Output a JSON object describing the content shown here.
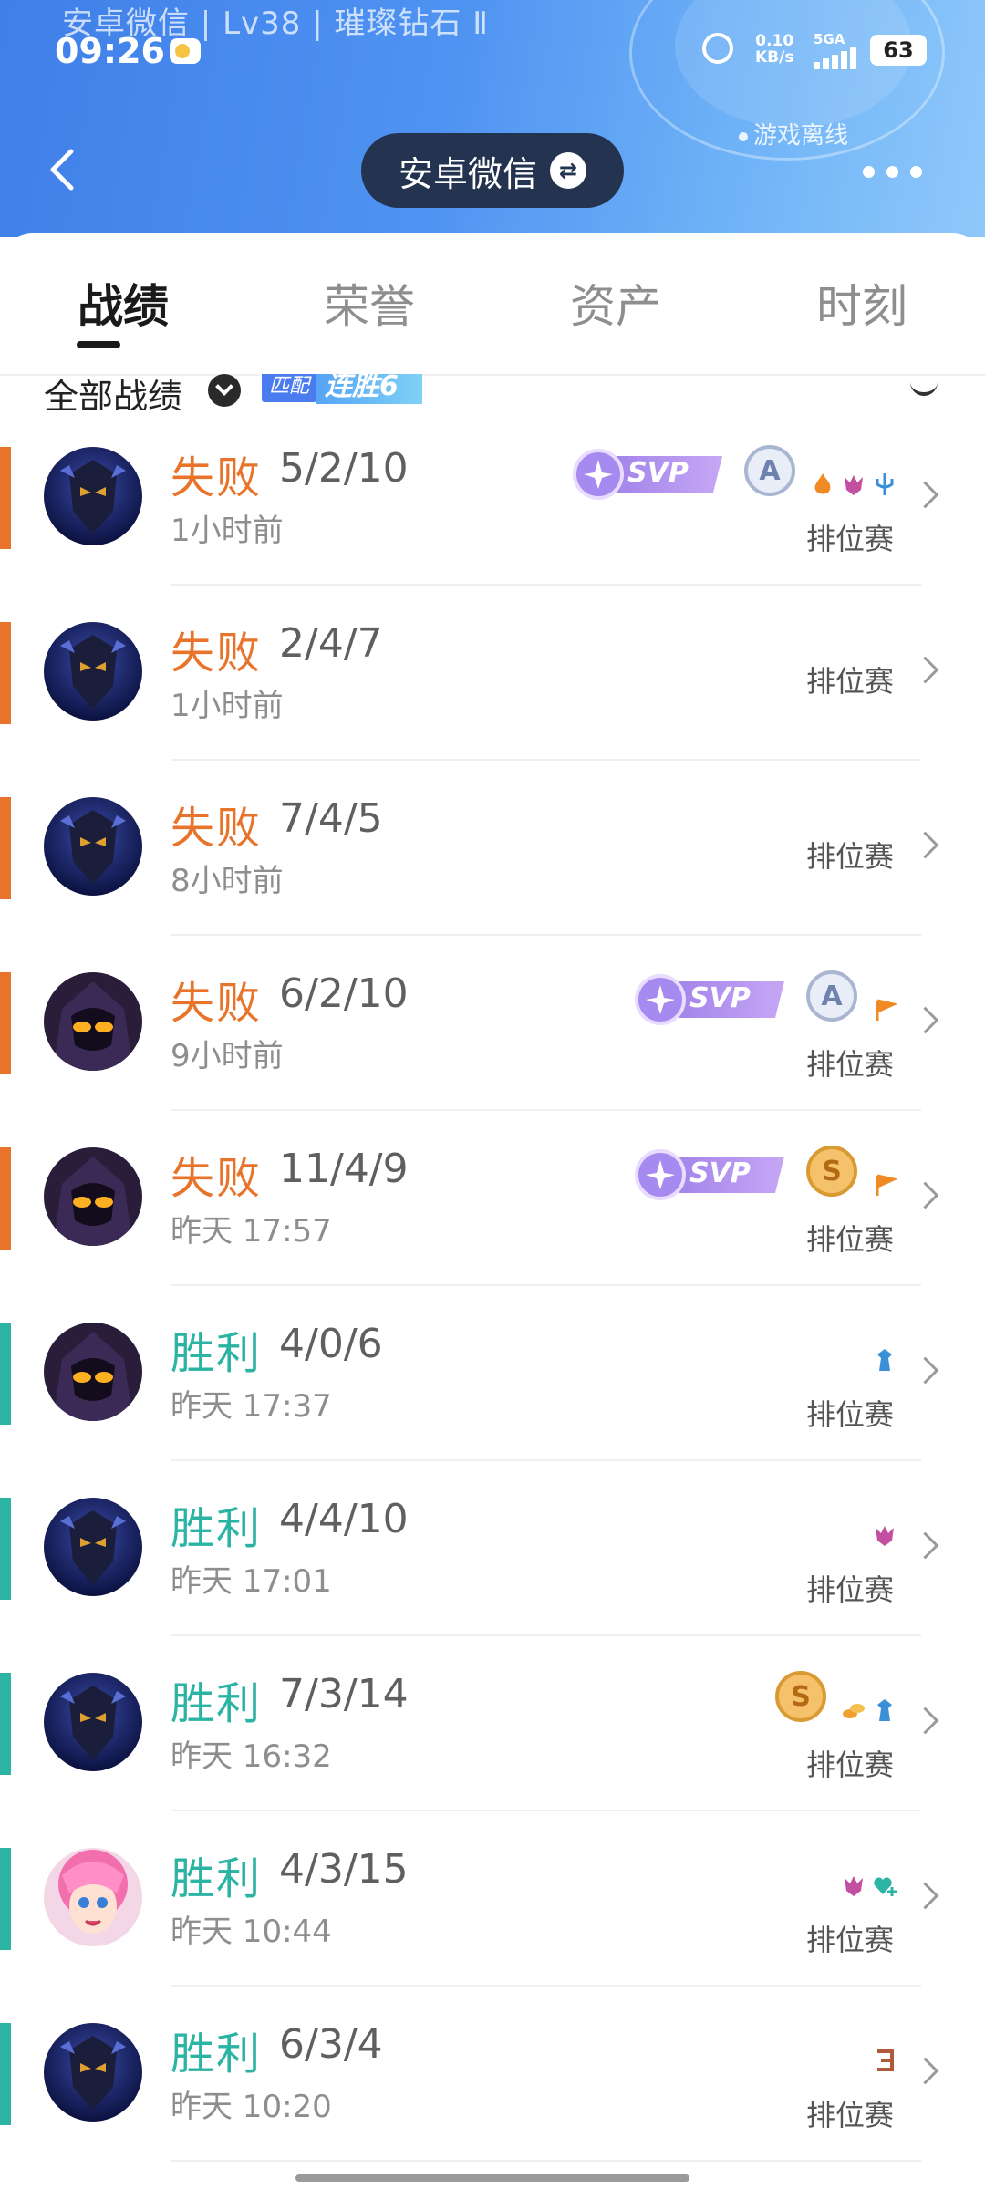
{
  "status_bar": {
    "banner": "安卓微信 | Lv38 | 璀璨钻石 Ⅱ",
    "time": "09:26",
    "net_speed_value": "0.10",
    "net_speed_unit": "KB/s",
    "net_type": "5GA",
    "battery": "63"
  },
  "header": {
    "game_status": "游戏离线",
    "account_name": "安卓微信",
    "swap_glyph": "⇄"
  },
  "tabs": [
    {
      "label": "战绩",
      "active": true
    },
    {
      "label": "荣誉",
      "active": false
    },
    {
      "label": "资产",
      "active": false
    },
    {
      "label": "时刻",
      "active": false
    }
  ],
  "filter": {
    "label": "全部战绩",
    "mode_tag": "匹配",
    "streak": "连胜6"
  },
  "colors": {
    "loss": "#e8742b",
    "win": "#2bb3a3",
    "header_blue": "#4f93f2",
    "pill_dark": "#24334f"
  },
  "matches": [
    {
      "result": "失败",
      "kda": "5/2/10",
      "time": "1小时前",
      "mode": "排位赛",
      "outcome": "loss",
      "hero": "dark-armor",
      "svp": "SVP",
      "rank": "A",
      "icons": [
        "fire-icon",
        "demon-icon",
        "trident-icon"
      ]
    },
    {
      "result": "失败",
      "kda": "2/4/7",
      "time": "1小时前",
      "mode": "排位赛",
      "outcome": "loss",
      "hero": "dark-armor"
    },
    {
      "result": "失败",
      "kda": "7/4/5",
      "time": "8小时前",
      "mode": "排位赛",
      "outcome": "loss",
      "hero": "dark-armor"
    },
    {
      "result": "失败",
      "kda": "6/2/10",
      "time": "9小时前",
      "mode": "排位赛",
      "outcome": "loss",
      "hero": "hooded-mage",
      "svp": "SVP",
      "rank": "A",
      "icons": [
        "flag-icon"
      ]
    },
    {
      "result": "失败",
      "kda": "11/4/9",
      "time": "昨天 17:57",
      "mode": "排位赛",
      "outcome": "loss",
      "hero": "hooded-mage",
      "svp": "SVP",
      "rank": "S",
      "icons": [
        "flag-icon"
      ]
    },
    {
      "result": "胜利",
      "kda": "4/0/6",
      "time": "昨天 17:37",
      "mode": "排位赛",
      "outcome": "win",
      "hero": "hooded-mage",
      "icons": [
        "tower-icon"
      ]
    },
    {
      "result": "胜利",
      "kda": "4/4/10",
      "time": "昨天 17:01",
      "mode": "排位赛",
      "outcome": "win",
      "hero": "dark-armor",
      "icons": [
        "demon-icon"
      ]
    },
    {
      "result": "胜利",
      "kda": "7/3/14",
      "time": "昨天 16:32",
      "mode": "排位赛",
      "outcome": "win",
      "hero": "dark-armor",
      "rank": "S",
      "icons": [
        "coins-icon",
        "tower-icon"
      ]
    },
    {
      "result": "胜利",
      "kda": "4/3/15",
      "time": "昨天 10:44",
      "mode": "排位赛",
      "outcome": "win",
      "hero": "pink-girl",
      "icons": [
        "demon-icon",
        "heart-plus-icon"
      ]
    },
    {
      "result": "胜利",
      "kda": "6/3/4",
      "time": "昨天 10:20",
      "mode": "排位赛",
      "outcome": "win",
      "hero": "dark-armor",
      "icons": [
        "triple-kill-icon"
      ]
    }
  ]
}
